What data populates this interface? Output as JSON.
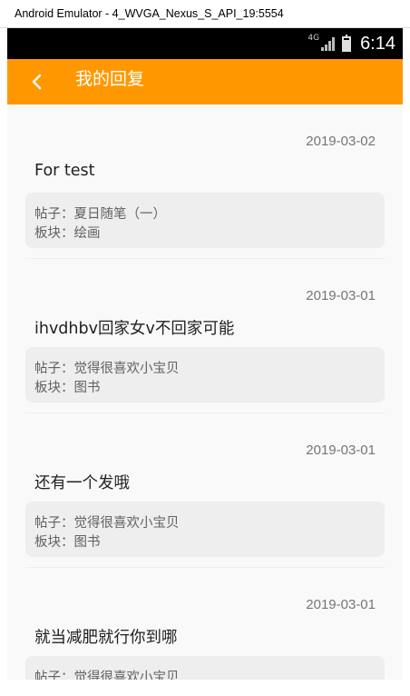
{
  "window": {
    "title": "Android Emulator - 4_WVGA_Nexus_S_API_19:5554"
  },
  "status_bar": {
    "network": "4G",
    "time": "6:14"
  },
  "app_bar": {
    "title": "我的回复"
  },
  "colors": {
    "app_bar": "#ff9800",
    "status_bar": "#000000",
    "background": "#f9f9f9",
    "card": "#eeeeee"
  },
  "labels": {
    "post_prefix": "帖子：",
    "board_prefix": "板块："
  },
  "replies": [
    {
      "date": "2019-03-02",
      "text": "For test",
      "post": "夏日随笔（一）",
      "board": "绘画"
    },
    {
      "date": "2019-03-01",
      "text": "ihvdhbv回家女v不回家可能",
      "post": "觉得很喜欢小宝贝",
      "board": "图书"
    },
    {
      "date": "2019-03-01",
      "text": "还有一个发哦",
      "post": "觉得很喜欢小宝贝",
      "board": "图书"
    },
    {
      "date": "2019-03-01",
      "text": "就当减肥就行你到哪",
      "post": "觉得很喜欢小宝贝",
      "board": ""
    }
  ]
}
